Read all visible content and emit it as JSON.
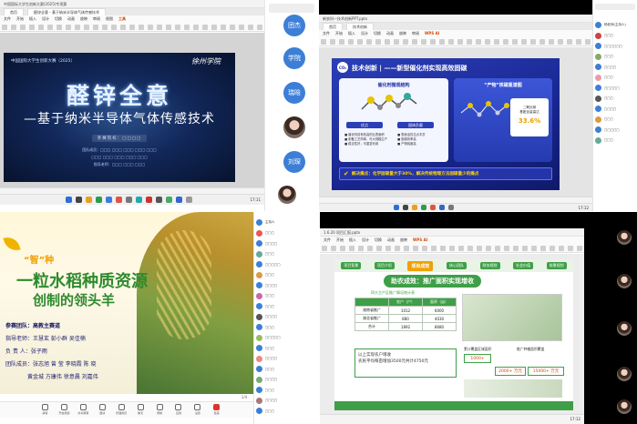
{
  "q1": {
    "app_title": "中国国际大学生创新大赛(2025)专项赛",
    "tabs": [
      "首页",
      "醛锌全意 - 基于纳米半导体气体传感技术"
    ],
    "menu": [
      "文件",
      "开始",
      "插入",
      "设计",
      "切换",
      "动画",
      "放映",
      "审阅",
      "视图",
      "工具",
      "会员专享",
      "WPS AI"
    ],
    "slide": {
      "banner": "中国国际大学生创新大赛（2025）",
      "school_logo": "徐州学院",
      "title": "醛锌全意",
      "subtitle": "—基于纳米半导体气体传感技术",
      "presenter": "参赛院校：□□□□",
      "members_1": "团队成员：□□□ □□□ □□□ □□□ □□□",
      "members_2": "□□□ □□□ □□□ □□□ □□□",
      "members_3": "指导老师：□□□ □□□ □□□"
    },
    "time": "17:11"
  },
  "q1_tiles": [
    "团杰",
    "学院",
    "瑞晗",
    "刘琛"
  ],
  "q2": {
    "app_title": "新农科—技术创新PPT.pptx",
    "tabs": [
      "首页",
      "技术创新"
    ],
    "menu": [
      "文件",
      "开始",
      "插入",
      "设计",
      "切换",
      "动画",
      "放映",
      "审阅",
      "视图",
      "工具",
      "会员专享",
      "WPS AI"
    ],
    "slide": {
      "heading": "技术创新 | ——新型催化剂实现高效固碳",
      "left_card": "催化剂微观结构",
      "right_card": "“产物”核磁氢谱图",
      "left_btn_1": "优点",
      "left_btn_2": "固体负载",
      "bullets_left": [
        "■ 催化剂具有较高的比表面积",
        "■ 制备工艺简单，可大规模生产",
        "■ 稳定性好，可重复利用"
      ],
      "bullets_right": [
        "■ 表面活性位点丰富",
        "■ 固碳效率高",
        "■ 产物纯度高"
      ],
      "metric_label": "二氧化碳\n基团含量高达",
      "metric_value": "33.6%",
      "conclusion": "解决痛点：化学固碳量大于30%，解决传统物理方法固碳量少的痛点"
    },
    "participants": [
      "主持人",
      "杨老师(主持人)",
      "成员",
      "□□□",
      "□□□□□□",
      "□□□",
      "□□□□",
      "□□□",
      "□□□□□",
      "□□□",
      "□□□□",
      "□□□",
      "□□□□□",
      "□□□"
    ],
    "time": "17:12"
  },
  "q3": {
    "slide": {
      "tag": "“智”种",
      "title_1": "一粒水稻种质资源",
      "title_2": "创制的领头羊",
      "school": "参赛团队：高教主赛道",
      "advisor": "指导老师：王慧玄 彭小群 吴佳楠",
      "leader": "负  责  人：张子雨",
      "team": "团队成员：张志旭 曾 莹 李晓霞 陈 晓",
      "team_2": "黄金城 方康伟 徐意晨 刘嘉伟"
    },
    "participants": [
      "主持人",
      "□□□",
      "□□□□",
      "□□□",
      "□□□□□",
      "□□□",
      "□□□□",
      "□□□",
      "□□□",
      "□□□□",
      "□□□",
      "□□□□□",
      "□□□",
      "□□□□",
      "□□□",
      "□□□□",
      "□□□",
      "□□□□",
      "□□□",
      "□□□",
      "□□□",
      "□□□□"
    ],
    "meeting_buttons": [
      "静音",
      "开启视频",
      "共享屏幕",
      "邀请",
      "管理成员",
      "聊天",
      "录制",
      "应用",
      "设置",
      "结束"
    ]
  },
  "q4": {
    "app_title": "1.6.20 项目汇报.pptx",
    "nav_tabs": [
      "项目背景",
      "项目介绍",
      "项目成效",
      "核心团队",
      "财务规划",
      "社会价值",
      "前景规划"
    ],
    "active_nav": "项目成效",
    "slide_title": "助农成效：推广面积实现增收",
    "table_caption": "四大主产区推广情况统计表",
    "table_head": [
      "",
      "农户（户）",
      "面积（亩）"
    ],
    "table_rows": [
      [
        "湖南省推广",
        "1012",
        "6000"
      ],
      [
        "湖北省推广",
        "880",
        "4030"
      ],
      [
        "合计",
        "1892",
        "8680"
      ]
    ],
    "callout": "以上实现农户增收\n农民平均每亩增加3500元共计4750元",
    "right_chart_1": "累计覆盖区域面积",
    "right_chart_2": "推广种植面积覆盖",
    "metric_a": "1000+",
    "metric_b": "2000+ 万元",
    "metric_c": "15000+ 万元",
    "time": "17:12"
  },
  "colors": {
    "q1_bg": "#0b1c3c",
    "q2_bg": "#1c2fa8",
    "q3_title": "#2e8b2e",
    "q4_green": "#3f9f48"
  }
}
